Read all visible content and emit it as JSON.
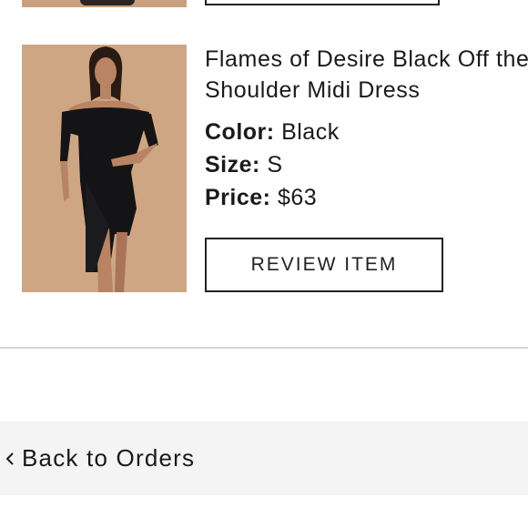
{
  "order_item": {
    "title": "Flames of Desire Black Off the\nShoulder Midi Dress",
    "color_label": "Color:",
    "color_value": "Black",
    "size_label": "Size:",
    "size_value": "S",
    "price_label": "Price:",
    "price_value": "$63",
    "review_button_label": "REVIEW ITEM",
    "image_description_icon": "product-photo"
  },
  "footer": {
    "back_label": "Back to Orders",
    "back_icon": "chevron-left-icon"
  },
  "colors": {
    "text": "#1a1a1a",
    "border": "#222222",
    "divider": "#d6d6d6",
    "back_bar_bg": "#f4f4f4",
    "image_bg": "#cfa684"
  }
}
